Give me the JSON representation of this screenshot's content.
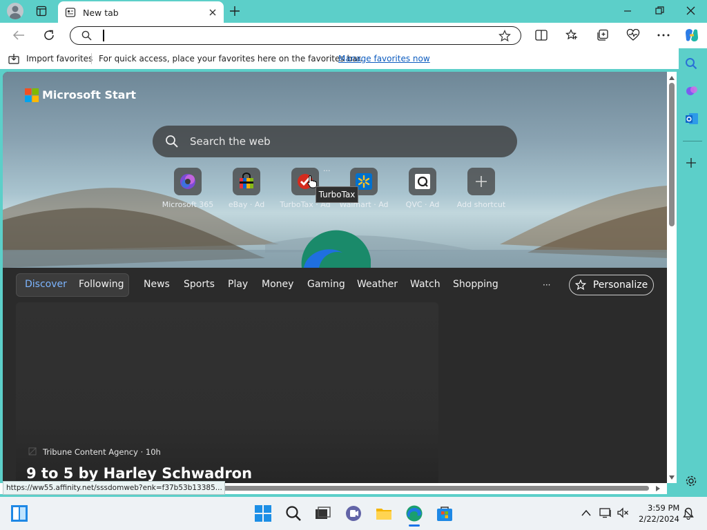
{
  "browser": {
    "tab_title": "New tab",
    "address_value": "",
    "favorites_bar": {
      "import_label": "Import favorites",
      "message": "For quick access, place your favorites here on the favorites bar.",
      "manage_link": "Manage favorites now"
    }
  },
  "page": {
    "brand": "Microsoft Start",
    "search_placeholder": "Search the web",
    "quick_links": [
      {
        "label": "Microsoft 365",
        "icon": "microsoft-365-icon"
      },
      {
        "label": "eBay · Ad",
        "icon": "ebay-icon"
      },
      {
        "label": "TurboTax · Ad",
        "icon": "turbotax-icon"
      },
      {
        "label": "Walmart · Ad",
        "icon": "walmart-icon"
      },
      {
        "label": "QVC · Ad",
        "icon": "qvc-icon"
      },
      {
        "label": "Add shortcut",
        "icon": "plus-icon"
      }
    ],
    "quick_link_more": "···",
    "tooltip": "TurboTax",
    "feed_tabs": {
      "discover": "Discover",
      "following": "Following",
      "items": [
        "News",
        "Sports",
        "Play",
        "Money",
        "Gaming",
        "Weather",
        "Watch",
        "Shopping"
      ],
      "more": "···",
      "personalize": "Personalize"
    },
    "card": {
      "source": "Tribune Content Agency · 10h",
      "title": "9 to 5 by Harley Schwadron"
    },
    "status_url": "https://ww55.affinity.net/sssdomweb?enk=f37b53b13385..."
  },
  "taskbar": {
    "time": "3:59 PM",
    "date": "2/22/2024"
  },
  "colors": {
    "chrome_teal": "#5ccfc9",
    "accent_blue": "#0b5bbf",
    "discover_blue": "#7db5ff"
  }
}
